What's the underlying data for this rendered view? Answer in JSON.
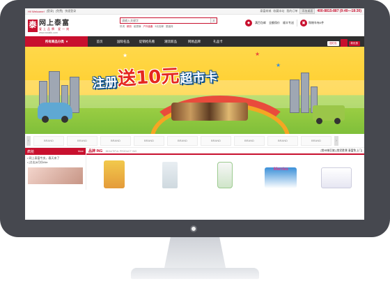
{
  "topbar": {
    "welcome": "Hi! Welcome!",
    "login": "[登录]",
    "register": "[免费]",
    "note": "快速登录",
    "right_links": [
      "泰富商城",
      "收藏本站",
      "我的订单"
    ],
    "install_btn": "添加桌面",
    "phone": "400-8815-887 (9:40—18:30)"
  },
  "header": {
    "logo_mark": "泰",
    "logo_name": "网上泰富",
    "logo_slogan": "爱上品牌 爱一刻",
    "logo_url": "www.wstaifu.com",
    "search_placeholder": "请输入关键字",
    "hot_words": [
      "热词",
      "鲜奶",
      "纸尿裤",
      "户外装备",
      "5元包邮",
      "夏装特"
    ],
    "services": [
      {
        "icon": "package-icon",
        "label": "满百包邮"
      },
      {
        "icon": "shield-icon",
        "label": "全额保价"
      },
      {
        "icon": "truck-icon",
        "label": "顺丰专送"
      }
    ],
    "cart_label": "购物车有0件"
  },
  "nav": {
    "category": "所有商品分类",
    "links": [
      "首页",
      "国际名品",
      "促销抢先看",
      "潮流新品",
      "网易品牌",
      "礼品卡"
    ],
    "promo_badge": "送红包",
    "promo_badge2": "新优惠"
  },
  "banner": {
    "line1": "注册",
    "line2": "送10元",
    "line3": "超市卡"
  },
  "brands": {
    "tiles": [
      "BRAND",
      "BRAND",
      "BRAND",
      "BRAND",
      "BRAND",
      "BRAND",
      "BRAND",
      "BRAND",
      "BRAND",
      "BRAND"
    ]
  },
  "left_panel": {
    "title": "疯抢",
    "more": "More",
    "news": [
      "• 网上泰富专卖，春天来了",
      "• [点击]6月份Alie"
    ]
  },
  "main_panel": {
    "title": "品牌 ING",
    "subtitle": "BEAUTIFUL PRODUCT ING",
    "ticker": "[常州嗨豆旅] [常武胜景 泰富免上门]",
    "merries": "Merries"
  }
}
